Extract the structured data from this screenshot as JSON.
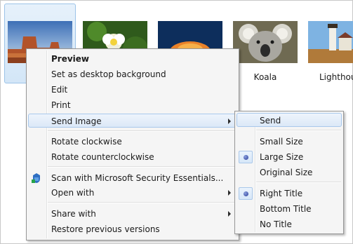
{
  "thumbnails": [
    {
      "id": "desert",
      "caption": ""
    },
    {
      "id": "flower",
      "caption": ""
    },
    {
      "id": "jellyfish",
      "caption": ""
    },
    {
      "id": "koala",
      "caption": "Koala"
    },
    {
      "id": "lighthouse",
      "caption": "Lighthou"
    }
  ],
  "context_menu": {
    "preview": "Preview",
    "set_desktop": "Set as desktop background",
    "edit": "Edit",
    "print": "Print",
    "send_image": "Send Image",
    "rotate_cw": "Rotate clockwise",
    "rotate_ccw": "Rotate counterclockwise",
    "scan": "Scan with Microsoft Security Essentials...",
    "open_with": "Open with",
    "share_with": "Share with",
    "restore": "Restore previous versions"
  },
  "submenu": {
    "send": "Send",
    "small_size": "Small Size",
    "large_size": "Large Size",
    "original_size": "Original Size",
    "right_title": "Right Title",
    "bottom_title": "Bottom Title",
    "no_title": "No Title"
  }
}
